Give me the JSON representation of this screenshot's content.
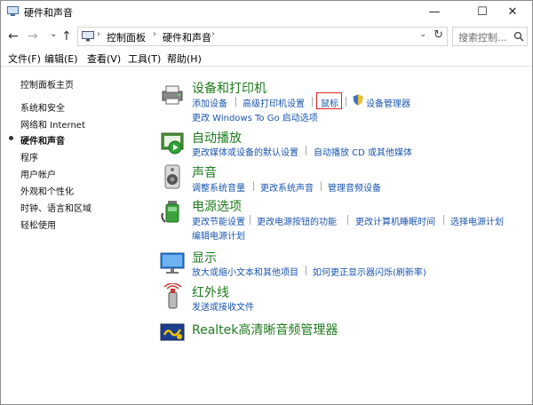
{
  "window": {
    "title": "硬件和声音",
    "minimize": "—",
    "maximize": "☐",
    "close": "✕"
  },
  "nav": {
    "back": "←",
    "forward": "→",
    "recent": "⌄",
    "up": "↑"
  },
  "address": {
    "crumbs": [
      "控制面板",
      "硬件和声音"
    ],
    "separator": "›",
    "dropdown": "⌄",
    "refresh": "↻"
  },
  "search": {
    "placeholder": "搜索控制..."
  },
  "menu": [
    "文件(F)",
    "编辑(E)",
    "查看(V)",
    "工具(T)",
    "帮助(H)"
  ],
  "sidebar": {
    "items": [
      {
        "label": "控制面板主页"
      },
      {
        "label": "系统和安全"
      },
      {
        "label": "网络和 Internet"
      },
      {
        "label": "硬件和声音",
        "active": true
      },
      {
        "label": "程序"
      },
      {
        "label": "用户帐户"
      },
      {
        "label": "外观和个性化"
      },
      {
        "label": "时钟、语言和区域"
      },
      {
        "label": "轻松使用"
      }
    ]
  },
  "categories": [
    {
      "title": "设备和打印机",
      "icon": "printer-icon",
      "links": [
        [
          "添加设备",
          "高级打印机设置",
          "鼠标",
          "设备管理器"
        ],
        [
          "更改 Windows To Go 启动选项"
        ]
      ],
      "highlighted": "鼠标"
    },
    {
      "title": "自动播放",
      "icon": "autoplay-icon",
      "links": [
        [
          "更改媒体或设备的默认设置",
          "自动播放 CD 或其他媒体"
        ]
      ]
    },
    {
      "title": "声音",
      "icon": "speaker-icon",
      "links": [
        [
          "调整系统音量",
          "更改系统声音",
          "管理音频设备"
        ]
      ]
    },
    {
      "title": "电源选项",
      "icon": "power-icon",
      "links": [
        [
          "更改节能设置",
          "更改电源按钮的功能",
          "更改计算机睡眠时间",
          "选择电源计划"
        ],
        [
          "编辑电源计划"
        ]
      ]
    },
    {
      "title": "显示",
      "icon": "display-icon",
      "links": [
        [
          "放大或缩小文本和其他项目",
          "如何更正显示器闪烁(刷新率)"
        ]
      ]
    },
    {
      "title": "红外线",
      "icon": "infrared-icon",
      "links": [
        [
          "发送或接收文件"
        ]
      ]
    },
    {
      "title": "Realtek高清晰音频管理器",
      "icon": "realtek-icon",
      "links": []
    }
  ],
  "colors": {
    "category_title": "#1e7a1e",
    "link": "#1a55b0",
    "highlight": "#e02020"
  }
}
